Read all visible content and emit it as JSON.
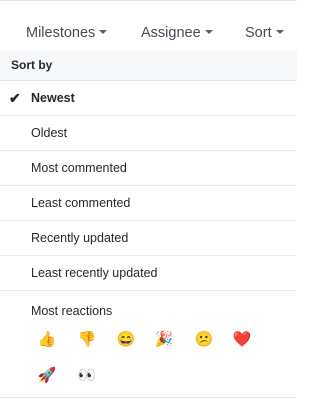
{
  "filters": {
    "milestones": "Milestones",
    "assignee": "Assignee",
    "sort": "Sort"
  },
  "sort_menu": {
    "header": "Sort by",
    "selected_check": "✔",
    "items": [
      {
        "label": "Newest",
        "selected": true
      },
      {
        "label": "Oldest",
        "selected": false
      },
      {
        "label": "Most commented",
        "selected": false
      },
      {
        "label": "Least commented",
        "selected": false
      },
      {
        "label": "Recently updated",
        "selected": false
      },
      {
        "label": "Least recently updated",
        "selected": false
      }
    ],
    "reactions_label": "Most reactions",
    "reactions": [
      {
        "name": "thumbs-up",
        "glyph": "👍"
      },
      {
        "name": "thumbs-down",
        "glyph": "👎"
      },
      {
        "name": "laugh",
        "glyph": "😄"
      },
      {
        "name": "hooray",
        "glyph": "🎉"
      },
      {
        "name": "confused",
        "glyph": "😕"
      },
      {
        "name": "heart",
        "glyph": "❤️"
      },
      {
        "name": "rocket",
        "glyph": "🚀"
      },
      {
        "name": "eyes",
        "glyph": "👀"
      }
    ]
  }
}
